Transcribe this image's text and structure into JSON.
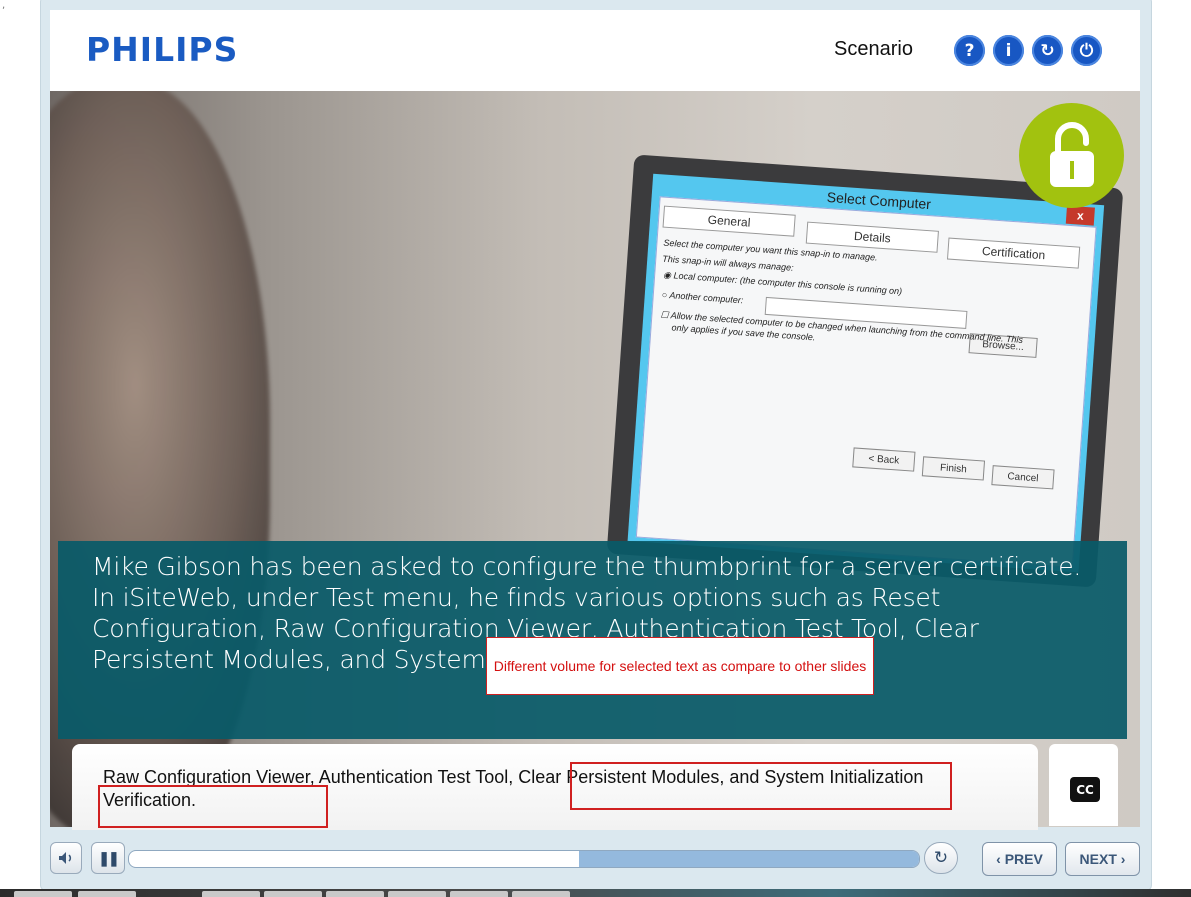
{
  "header": {
    "logo": "PHILIPS",
    "menu_label": "Scenario",
    "buttons": [
      {
        "glyph": "?",
        "icon": "help-icon"
      },
      {
        "glyph": "i",
        "icon": "info-icon"
      },
      {
        "glyph": "↻",
        "icon": "replay-icon"
      },
      {
        "glyph": "⏻",
        "icon": "power-icon"
      }
    ]
  },
  "slide": {
    "dialog": {
      "title": "Select Computer",
      "close": "x",
      "tabs": [
        "General",
        "Details",
        "Certification"
      ],
      "prompt": "Select the computer you want this snap-in to manage.",
      "always_manage": "This snap-in will always manage:",
      "local_option": "Local computer:  (the computer this console is running on)",
      "another_option": "Another computer:",
      "browse": "Browse...",
      "allow_change": "Allow the selected computer to be changed when launching from the command line.  This",
      "allow_change_2": "only applies if you save the console.",
      "back": "< Back",
      "finish": "Finish",
      "cancel": "Cancel"
    },
    "narration": "Mike Gibson has been asked to configure the thumbprint for a server certificate. In iSiteWeb, under Test menu, he finds various options such as Reset Configuration, Raw Configuration Viewer, Authentication Test Tool, Clear Persistent Modules, and System Initialization Verification."
  },
  "annotation": {
    "note": "Different volume for selected text as compare to other slides"
  },
  "caption": {
    "text": "Raw Configuration Viewer, Authentication Test Tool, Clear Persistent Modules, and System Initialization Verification.",
    "cc_label": "CC"
  },
  "controls": {
    "pause_glyph": "❚❚",
    "progress": 0.57,
    "prev_label": "‹ PREV",
    "next_label": "NEXT ›"
  }
}
